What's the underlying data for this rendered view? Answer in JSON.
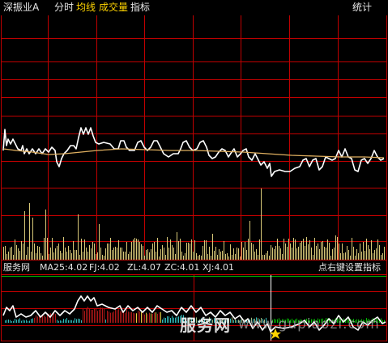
{
  "header": {
    "stock_name": "深振业A",
    "tabs": [
      {
        "label": "分时",
        "color": "#e8e8e8"
      },
      {
        "label": "均线",
        "color": "#ffd400"
      },
      {
        "label": "成交量",
        "color": "#ffd400"
      },
      {
        "label": "指标",
        "color": "#e8e8e8"
      }
    ],
    "stats_label": "统计"
  },
  "indicator": {
    "name": "服务网",
    "ma25": "MA25:4.02",
    "fj": "FJ:4.02",
    "zl": "ZL:4.07",
    "zc": "ZC:4.01",
    "xj": "XJ:4.01",
    "hint": "点右键设置指标"
  },
  "watermark": {
    "text": "服务网",
    "url": "www.gupiaozi.com"
  },
  "colors": {
    "grid": "#c00000",
    "price_line": "#ffffff",
    "avg_line": "#e0b060",
    "volume": "#d8c878",
    "accent_yellow": "#ffd400",
    "indicator_green": "#00c000",
    "indicator_red": "#b01818",
    "indicator_cyan": "#30c0c0"
  }
}
